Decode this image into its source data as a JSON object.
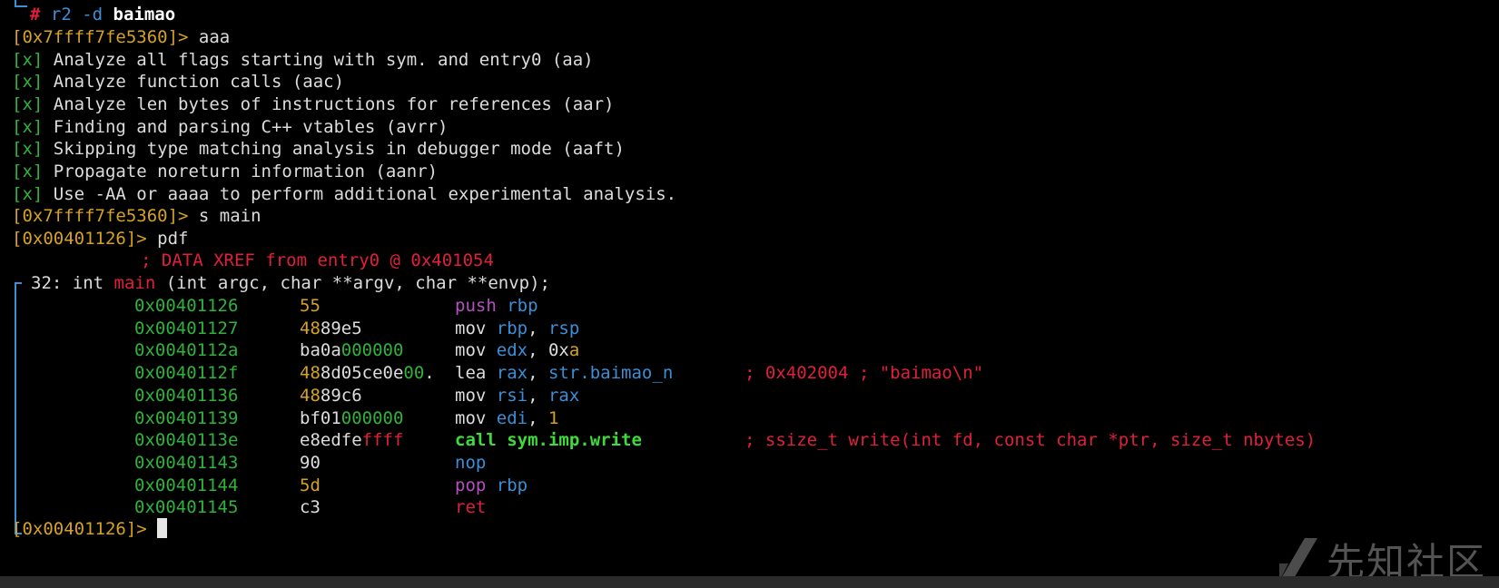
{
  "prompt": {
    "hash": "#",
    "command": "r2 -d ",
    "arg": "baimao"
  },
  "lines": {
    "p1": {
      "addr": "[0x7ffff7fe5360]>",
      "cmd": " aaa"
    },
    "a1": {
      "mark": "[x]",
      "text": " Analyze all flags starting with sym. and entry0 (aa)"
    },
    "a2": {
      "mark": "[x]",
      "text": " Analyze function calls (aac)"
    },
    "a3": {
      "mark": "[x]",
      "text": " Analyze len bytes of instructions for references (aar)"
    },
    "a4": {
      "mark": "[x]",
      "text": " Finding and parsing C++ vtables (avrr)"
    },
    "a5": {
      "mark": "[x]",
      "text": " Skipping type matching analysis in debugger mode (aaft)"
    },
    "a6": {
      "mark": "[x]",
      "text": " Propagate noreturn information (aanr)"
    },
    "a7": {
      "mark": "[x]",
      "text": " Use -AA or aaaa to perform additional experimental analysis."
    },
    "p2": {
      "addr": "[0x7ffff7fe5360]>",
      "cmd": " s main"
    },
    "p3": {
      "addr": "[0x00401126]>",
      "cmd": " pdf"
    },
    "xref": "; DATA XREF from entry0 @ 0x401054",
    "sig": {
      "prefix": "32: int ",
      "name": "main",
      "args": " (int argc, char **argv, char **envp);"
    },
    "p4": {
      "addr": "[0x00401126]>"
    }
  },
  "disasm": [
    {
      "addr": "0x00401126",
      "bytes": [
        {
          "t": "55",
          "c": "y"
        }
      ],
      "m": "push",
      "mc": "purple",
      "ops": [
        {
          "t": " rbp",
          "c": "blue"
        }
      ]
    },
    {
      "addr": "0x00401127",
      "bytes": [
        {
          "t": "48",
          "c": "y"
        },
        {
          "t": "89e5",
          "c": "w"
        }
      ],
      "m": "mov",
      "mc": "white",
      "ops": [
        {
          "t": " rbp",
          "c": "blue"
        },
        {
          "t": ", ",
          "c": "w"
        },
        {
          "t": "rsp",
          "c": "blue"
        }
      ]
    },
    {
      "addr": "0x0040112a",
      "bytes": [
        {
          "t": "ba0a",
          "c": "w"
        },
        {
          "t": "000000",
          "c": "g"
        }
      ],
      "m": "mov",
      "mc": "white",
      "ops": [
        {
          "t": " edx",
          "c": "blue"
        },
        {
          "t": ", ",
          "c": "w"
        },
        {
          "t": "0x",
          "c": "w"
        },
        {
          "t": "a",
          "c": "y"
        }
      ]
    },
    {
      "addr": "0x0040112f",
      "bytes": [
        {
          "t": "48",
          "c": "y"
        },
        {
          "t": "8d05ce0e",
          "c": "w"
        },
        {
          "t": "00",
          "c": "g"
        },
        {
          "t": ".",
          "c": "w"
        }
      ],
      "m": "lea",
      "mc": "white",
      "ops": [
        {
          "t": " rax",
          "c": "blue"
        },
        {
          "t": ", ",
          "c": "w"
        },
        {
          "t": "str.baimao_n",
          "c": "blue"
        }
      ],
      "comment": "; 0x402004 ; \"baimao\\n\""
    },
    {
      "addr": "0x00401136",
      "bytes": [
        {
          "t": "48",
          "c": "y"
        },
        {
          "t": "89c6",
          "c": "w"
        }
      ],
      "m": "mov",
      "mc": "white",
      "ops": [
        {
          "t": " rsi",
          "c": "blue"
        },
        {
          "t": ", ",
          "c": "w"
        },
        {
          "t": "rax",
          "c": "blue"
        }
      ]
    },
    {
      "addr": "0x00401139",
      "bytes": [
        {
          "t": "bf01",
          "c": "w"
        },
        {
          "t": "000000",
          "c": "g"
        }
      ],
      "m": "mov",
      "mc": "white",
      "ops": [
        {
          "t": " edi",
          "c": "blue"
        },
        {
          "t": ", ",
          "c": "w"
        },
        {
          "t": "1",
          "c": "y"
        }
      ]
    },
    {
      "addr": "0x0040113e",
      "bytes": [
        {
          "t": "e8edfe",
          "c": "w"
        },
        {
          "t": "ffff",
          "c": "r"
        }
      ],
      "m": "call sym.imp.write",
      "mc": "bgreen",
      "ops": [],
      "comment": "; ssize_t write(int fd, const char *ptr, size_t nbytes)"
    },
    {
      "addr": "0x00401143",
      "bytes": [
        {
          "t": "90",
          "c": "w"
        }
      ],
      "m": "nop",
      "mc": "blue",
      "ops": []
    },
    {
      "addr": "0x00401144",
      "bytes": [
        {
          "t": "5d",
          "c": "y"
        }
      ],
      "m": "pop",
      "mc": "purple",
      "ops": [
        {
          "t": " rbp",
          "c": "blue"
        }
      ]
    },
    {
      "addr": "0x00401145",
      "bytes": [
        {
          "t": "c3",
          "c": "w"
        }
      ],
      "m": "ret",
      "mc": "red",
      "ops": []
    }
  ],
  "colors": {
    "background": "#000000",
    "green": "#2fb33a",
    "yellow": "#d6a21f",
    "red": "#e0203a",
    "blue": "#3b8fd6",
    "purple": "#b64fbf"
  },
  "watermark": {
    "text": "先知社区",
    "icon": "xianzhi-logo-icon"
  }
}
